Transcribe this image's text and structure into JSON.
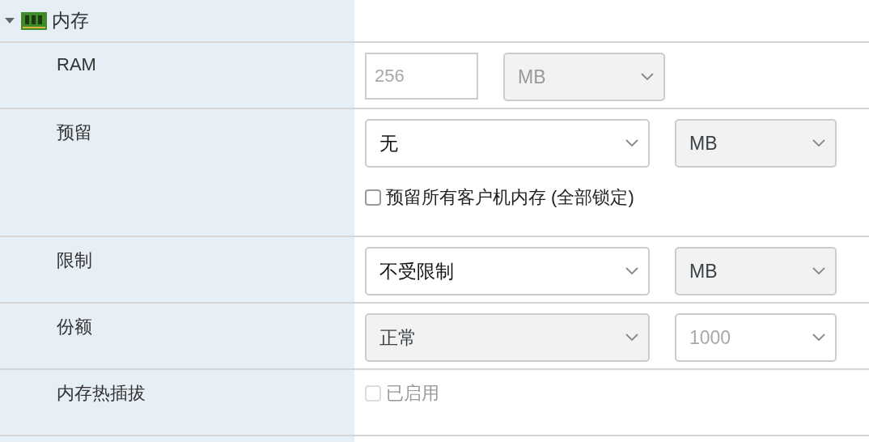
{
  "section": {
    "title": "内存",
    "expanded": true
  },
  "rows": [
    {
      "label": "RAM",
      "controls": [
        {
          "kind": "input",
          "value": "256",
          "disabled": true,
          "shaded": false
        },
        {
          "kind": "select",
          "value": "MB",
          "disabled": true,
          "shaded": true
        }
      ]
    },
    {
      "label": "预留",
      "controls": [
        {
          "kind": "select",
          "value": "无",
          "disabled": false,
          "shaded": false
        },
        {
          "kind": "select",
          "value": "MB",
          "disabled": false,
          "shaded": true
        },
        {
          "kind": "checkbox",
          "label": "预留所有客户机内存 (全部锁定)",
          "checked": false,
          "disabled": false
        }
      ]
    },
    {
      "label": "限制",
      "controls": [
        {
          "kind": "select",
          "value": "不受限制",
          "disabled": false,
          "shaded": false
        },
        {
          "kind": "select",
          "value": "MB",
          "disabled": false,
          "shaded": true
        }
      ]
    },
    {
      "label": "份额",
      "controls": [
        {
          "kind": "select",
          "value": "正常",
          "disabled": false,
          "shaded": true
        },
        {
          "kind": "select",
          "value": "1000",
          "disabled": true,
          "shaded": false
        }
      ]
    },
    {
      "label": "内存热插拔",
      "controls": [
        {
          "kind": "checkbox",
          "label": "已启用",
          "checked": false,
          "disabled": true
        }
      ]
    }
  ]
}
